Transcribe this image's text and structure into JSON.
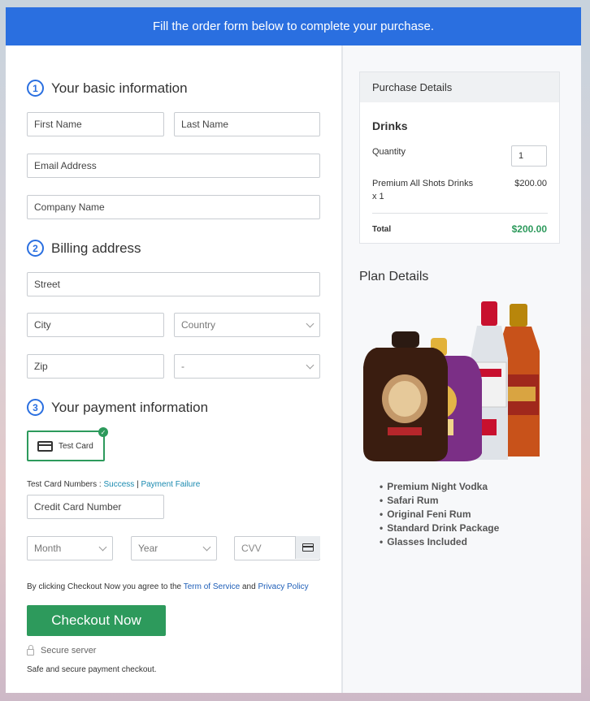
{
  "banner": {
    "text": "Fill the order form below to complete your purchase."
  },
  "sections": {
    "basic": {
      "num": "1",
      "title": "Your basic information"
    },
    "billing": {
      "num": "2",
      "title": "Billing address"
    },
    "payment": {
      "num": "3",
      "title": "Your payment information"
    }
  },
  "fields": {
    "first_name": "First Name",
    "last_name": "Last Name",
    "email": "Email Address",
    "company": "Company Name",
    "street": "Street",
    "city": "City",
    "country": "Country",
    "zip": "Zip",
    "state": "-",
    "credit_card": "Credit Card Number",
    "month": "Month",
    "year": "Year",
    "cvv": "CVV"
  },
  "payment": {
    "card_option": "Test Card",
    "test_numbers_label": "Test Card Numbers :",
    "success_link": "Success",
    "separator": "|",
    "failure_link": "Payment Failure"
  },
  "terms": {
    "prefix": "By clicking Checkout Now you agree to the",
    "tos_link": "Term of Service",
    "and": "and",
    "privacy_link": "Privacy Policy"
  },
  "checkout_button": "Checkout Now",
  "secure_server": "Secure server",
  "safe_text": "Safe and secure payment checkout.",
  "purchase_details": {
    "title": "Purchase Details",
    "product_group": "Drinks",
    "quantity_label": "Quantity",
    "quantity_value": "1",
    "item_name": "Premium All Shots Drinks",
    "item_qty": "x 1",
    "item_price": "$200.00",
    "total_label": "Total",
    "total_value": "$200.00"
  },
  "plan_details": {
    "title": "Plan Details",
    "items": [
      "Premium Night Vodka",
      "Safari Rum",
      "Original Feni Rum",
      "Standard Drink Package",
      "Glasses Included"
    ]
  },
  "colors": {
    "primary": "#2a6fe0",
    "success": "#2d9a5c",
    "total": "#2d9a5c"
  }
}
